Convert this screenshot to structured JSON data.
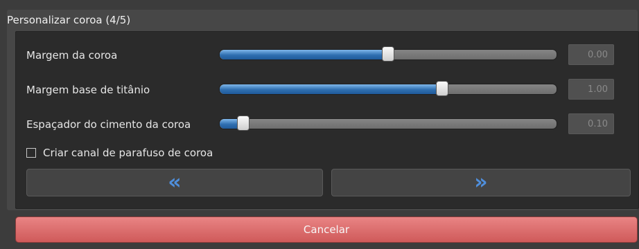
{
  "panel": {
    "title": "Personalizar coroa (4/5)"
  },
  "sliders": [
    {
      "label": "Margem da coroa",
      "value_text": "0.00",
      "level_percent": 50
    },
    {
      "label": "Margem base de titânio",
      "value_text": "1.00",
      "level_percent": 66
    },
    {
      "label": "Espaçador do cimento da coroa",
      "value_text": "0.10",
      "level_percent": 7
    }
  ],
  "checkbox": {
    "label": "Criar canal de parafuso de coroa",
    "checked": false
  },
  "nav": {
    "back_icon": "«",
    "next_icon": "»"
  },
  "cancel_button": {
    "label": "Cancelar"
  },
  "colors": {
    "slider_fill": "#2f6fb0",
    "cancel": "#d96868",
    "chevron": "#4f8fdc"
  }
}
